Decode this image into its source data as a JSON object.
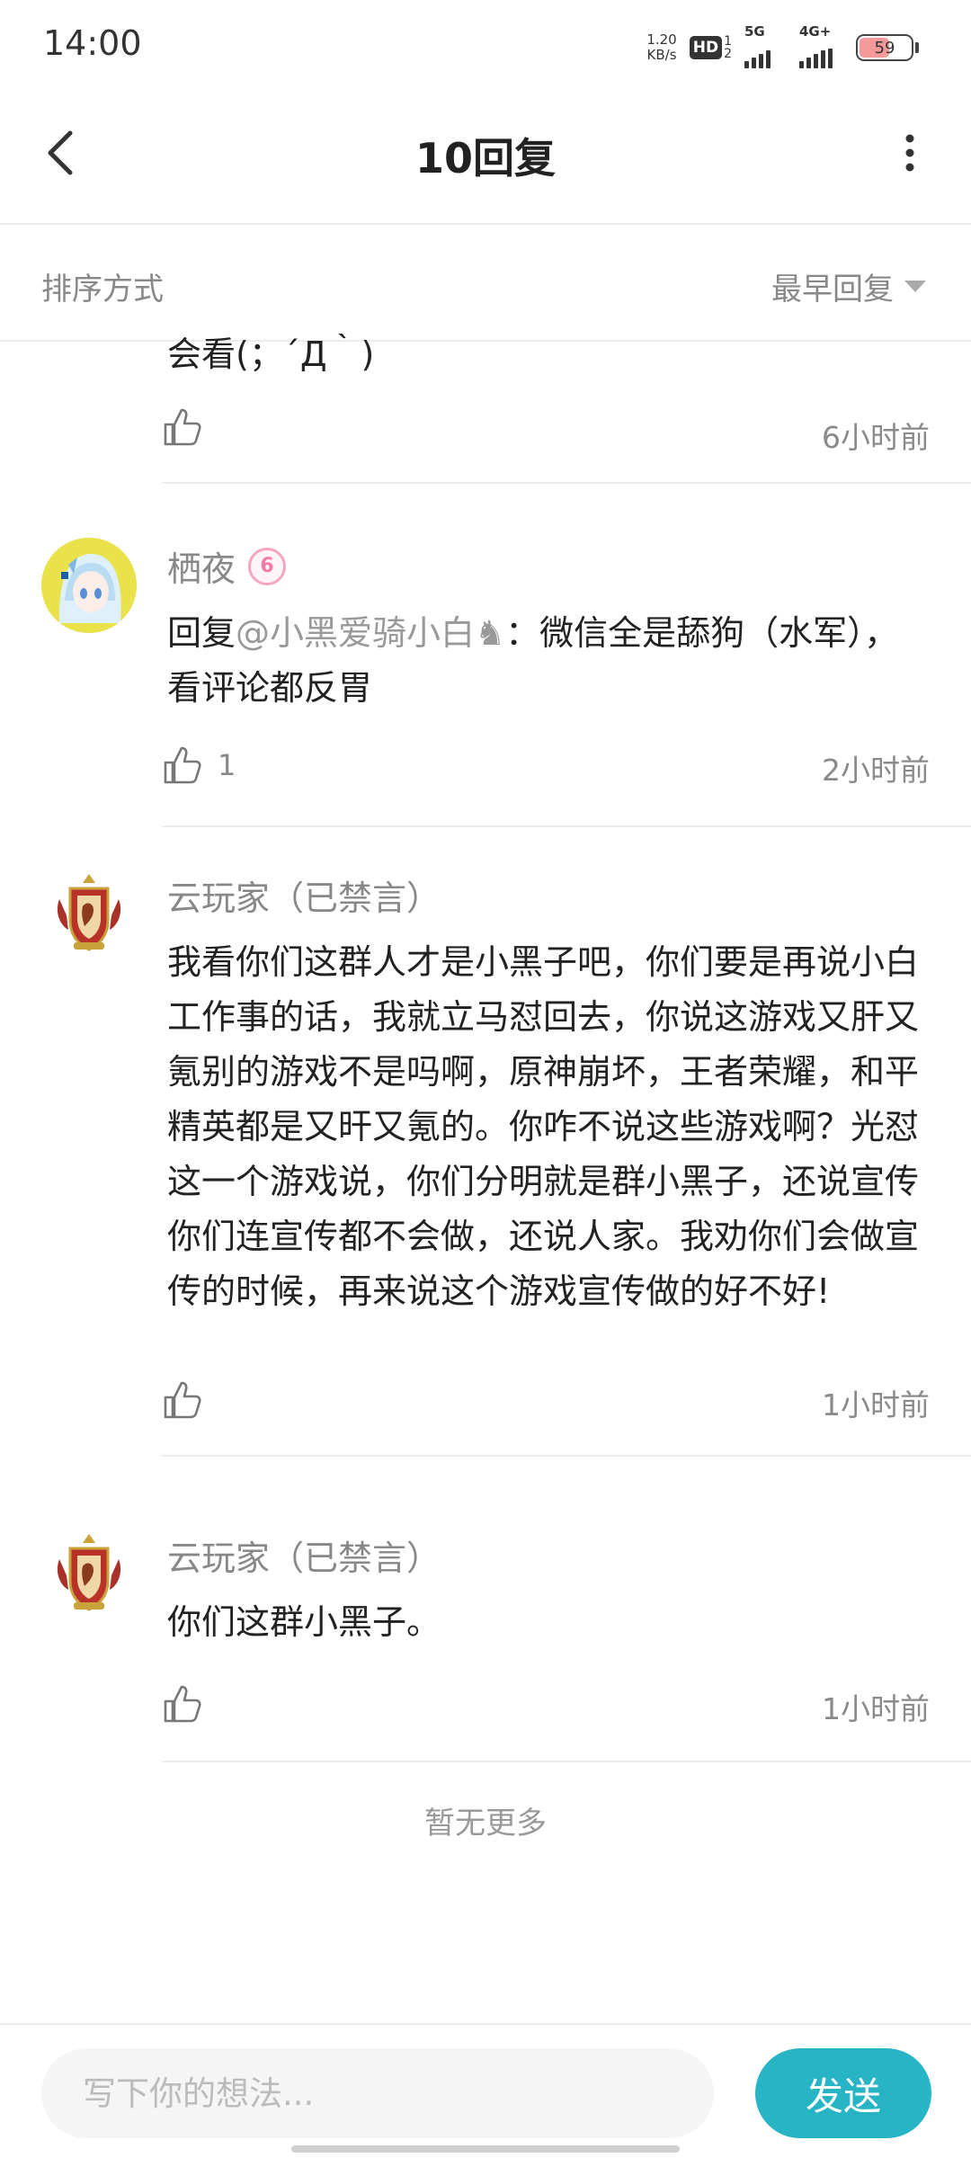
{
  "status_bar": {
    "time": "14:00",
    "net_speed_value": "1.20",
    "net_speed_unit": "KB/s",
    "hd_label": "HD",
    "sim_1": "1",
    "sim_2": "2",
    "network_1": "5G",
    "network_2": "4G+",
    "battery_level": "59"
  },
  "header": {
    "title": "10回复"
  },
  "sort": {
    "label": "排序方式",
    "selected": "最早回复"
  },
  "comments": [
    {
      "username": "",
      "body": "会看(；´Д｀)",
      "likes": "",
      "time": "6小时前"
    },
    {
      "username": "栖夜",
      "level_badge": "6",
      "reply_prefix": "回复",
      "mention": "@小黑爱骑小白♞",
      "body": "：微信全是舔狗（水军），看评论都反胃",
      "likes": "1",
      "time": "2小时前"
    },
    {
      "username": "云玩家（已禁言）",
      "body": "我看你们这群人才是小黑子吧，你们要是再说小白工作事的话，我就立马怼回去，你说这游戏又肝又氪别的游戏不是吗啊，原神崩坏，王者荣耀，和平精英都是又旰又氪的。你咋不说这些游戏啊？光怼这一个游戏说，你们分明就是群小黑子，还说宣传你们连宣传都不会做，还说人家。我劝你们会做宣传的时候，再来说这个游戏宣传做的好不好!",
      "likes": "",
      "time": "1小时前"
    },
    {
      "username": "云玩家（已禁言）",
      "body": "你们这群小黑子。",
      "likes": "",
      "time": "1小时前"
    }
  ],
  "footer_note": "暂无更多",
  "input": {
    "placeholder": "写下你的想法...",
    "send_label": "发送"
  },
  "colors": {
    "accent": "#27b5c5",
    "level_badge": "#f27aa3",
    "battery_fill": "#f59a9a"
  },
  "icons": {
    "back": "chevron-left-icon",
    "more": "more-vertical-icon",
    "like": "thumbs-up-icon",
    "sort_caret": "caret-down-icon"
  }
}
